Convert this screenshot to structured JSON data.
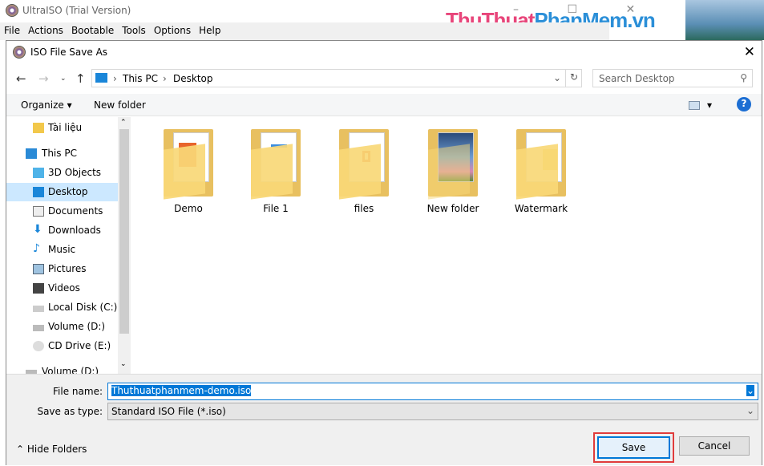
{
  "app": {
    "title": "UltraISO (Trial Version)",
    "menu": [
      "File",
      "Actions",
      "Bootable",
      "Tools",
      "Options",
      "Help"
    ],
    "watermark_a": "ThuThuat",
    "watermark_b": "PhanMem",
    "watermark_c": ".vn"
  },
  "dialog": {
    "title": "ISO File Save As",
    "breadcrumb": [
      "This PC",
      "Desktop"
    ],
    "search_placeholder": "Search Desktop",
    "toolbar": {
      "organize": "Organize",
      "new_folder": "New folder"
    },
    "sidebar": [
      "Tài liệu",
      "This PC",
      "3D Objects",
      "Desktop",
      "Documents",
      "Downloads",
      "Music",
      "Pictures",
      "Videos",
      "Local Disk (C:)",
      "Volume (D:)",
      "CD Drive (E:)",
      "Volume (D:)"
    ],
    "folders": [
      "Demo",
      "File 1",
      "files",
      "New folder",
      "Watermark"
    ],
    "file_name_label": "File name:",
    "file_name": "Thuthuatphanmem-demo.iso",
    "save_type_label": "Save as type:",
    "save_type": "Standard ISO File (*.iso)",
    "hide_folders": "Hide Folders",
    "save": "Save",
    "cancel": "Cancel"
  },
  "colors": {
    "accent": "#0078d7",
    "highlight": "#e03c3c",
    "brand_red": "#e8457a",
    "brand_blue": "#2b8fd8"
  }
}
